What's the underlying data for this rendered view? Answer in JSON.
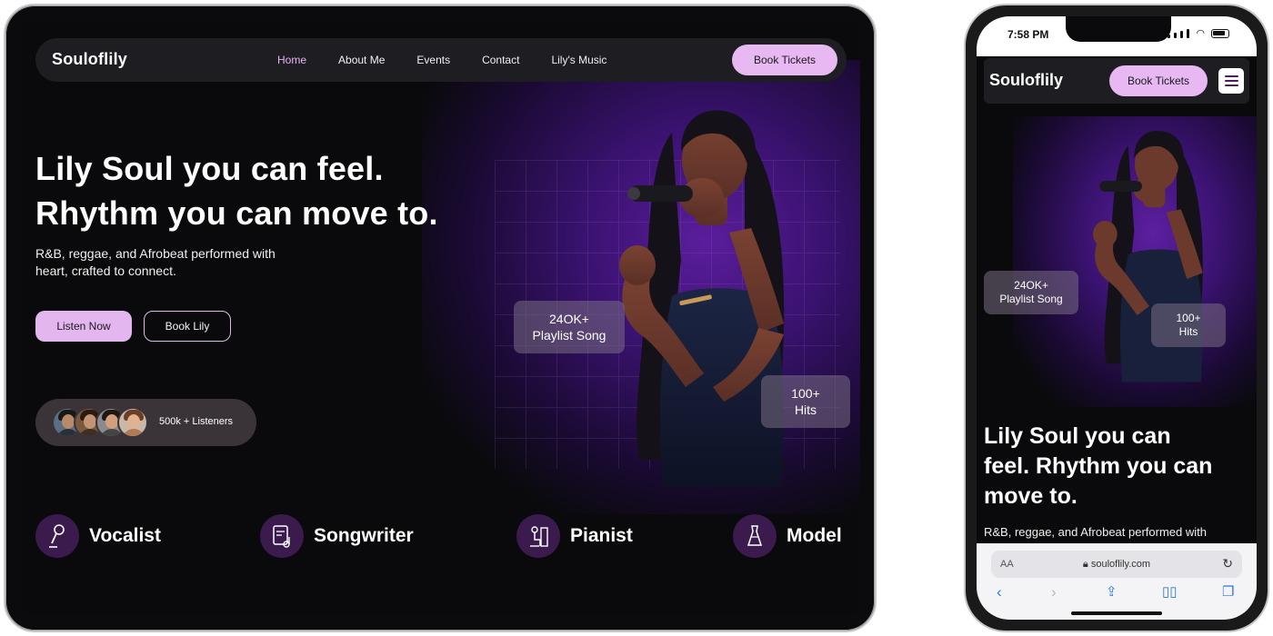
{
  "tablet": {
    "nav": {
      "logo": "Souloflily",
      "links": [
        {
          "label": "Home",
          "active": true
        },
        {
          "label": "About Me",
          "active": false
        },
        {
          "label": "Events",
          "active": false
        },
        {
          "label": "Contact",
          "active": false
        },
        {
          "label": "Lily's Music",
          "active": false
        }
      ],
      "book_label": "Book Tickets"
    },
    "hero": {
      "headline_line1": "Lily Soul you can feel.",
      "headline_line2": "Rhythm you can move to.",
      "subtitle": "R&B, reggae, and Afrobeat performed with heart, crafted to connect.",
      "listen_label": "Listen Now",
      "book_lily_label": "Book Lily",
      "listeners_label": "500k + Listeners"
    },
    "stats": [
      {
        "value": "24OK+",
        "label": "Playlist Song"
      },
      {
        "value": "100+",
        "label": "Hits"
      }
    ],
    "roles": [
      {
        "label": "Vocalist",
        "icon": "microphone-icon"
      },
      {
        "label": "Songwriter",
        "icon": "music-sheet-icon"
      },
      {
        "label": "Pianist",
        "icon": "piano-player-icon"
      },
      {
        "label": "Model",
        "icon": "dress-icon"
      }
    ]
  },
  "phone": {
    "status": {
      "time": "7:58 PM"
    },
    "nav": {
      "logo": "Souloflily",
      "book_label": "Book Tickets"
    },
    "headline": "Lily Soul you can feel. Rhythm you can move to.",
    "subtitle": "R&B, reggae, and Afrobeat performed with",
    "stats": [
      {
        "value": "24OK+",
        "label": "Playlist Song"
      },
      {
        "value": "100+",
        "label": "Hits"
      }
    ],
    "browser": {
      "aa": "AA",
      "domain": "souloflily.com"
    }
  },
  "colors": {
    "accent": "#e7b8f2",
    "background": "#0a0a0c",
    "glow": "#5b1d9c",
    "role_icon_bg": "#3b1a4d"
  }
}
